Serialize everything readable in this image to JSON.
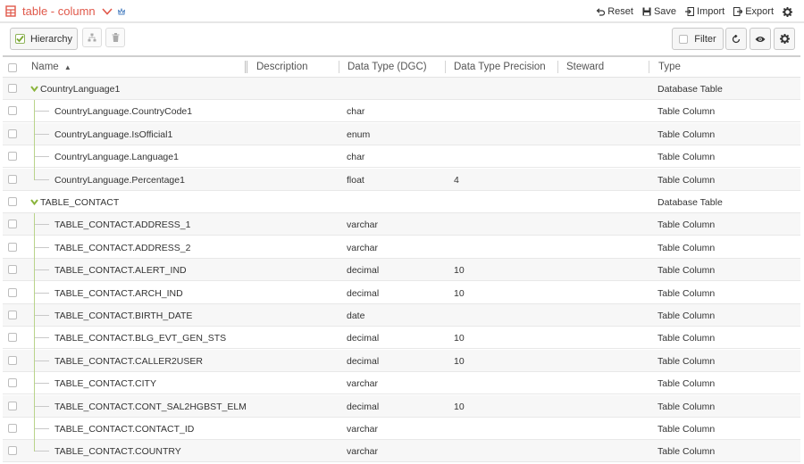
{
  "header": {
    "title": "table - column",
    "actions": [
      {
        "name": "reset",
        "label": "Reset",
        "icon": "undo-icon"
      },
      {
        "name": "save",
        "label": "Save",
        "icon": "save-icon"
      },
      {
        "name": "import",
        "label": "Import",
        "icon": "import-icon"
      },
      {
        "name": "export",
        "label": "Export",
        "icon": "export-icon"
      }
    ]
  },
  "toolbar": {
    "hierarchy_label": "Hierarchy",
    "filter_label": "Filter"
  },
  "columns": [
    "Name",
    "Description",
    "Data Type (DGC)",
    "Data Type Precision",
    "Steward",
    "Type"
  ],
  "sort_indicator": "▲",
  "rows": [
    {
      "level": 0,
      "name": "CountryLanguage1",
      "description": "",
      "data_type": "",
      "precision": "",
      "steward": "",
      "type": "Database Table"
    },
    {
      "level": 1,
      "name": "CountryLanguage.CountryCode1",
      "description": "",
      "data_type": "char",
      "precision": "",
      "steward": "",
      "type": "Table Column"
    },
    {
      "level": 1,
      "name": "CountryLanguage.IsOfficial1",
      "description": "",
      "data_type": "enum",
      "precision": "",
      "steward": "",
      "type": "Table Column"
    },
    {
      "level": 1,
      "name": "CountryLanguage.Language1",
      "description": "",
      "data_type": "char",
      "precision": "",
      "steward": "",
      "type": "Table Column"
    },
    {
      "level": 1,
      "name": "CountryLanguage.Percentage1",
      "description": "",
      "data_type": "float",
      "precision": "4",
      "steward": "",
      "type": "Table Column"
    },
    {
      "level": 0,
      "name": "TABLE_CONTACT",
      "description": "",
      "data_type": "",
      "precision": "",
      "steward": "",
      "type": "Database Table"
    },
    {
      "level": 1,
      "name": "TABLE_CONTACT.ADDRESS_1",
      "description": "",
      "data_type": "varchar",
      "precision": "",
      "steward": "",
      "type": "Table Column"
    },
    {
      "level": 1,
      "name": "TABLE_CONTACT.ADDRESS_2",
      "description": "",
      "data_type": "varchar",
      "precision": "",
      "steward": "",
      "type": "Table Column"
    },
    {
      "level": 1,
      "name": "TABLE_CONTACT.ALERT_IND",
      "description": "",
      "data_type": "decimal",
      "precision": "10",
      "steward": "",
      "type": "Table Column"
    },
    {
      "level": 1,
      "name": "TABLE_CONTACT.ARCH_IND",
      "description": "",
      "data_type": "decimal",
      "precision": "10",
      "steward": "",
      "type": "Table Column"
    },
    {
      "level": 1,
      "name": "TABLE_CONTACT.BIRTH_DATE",
      "description": "",
      "data_type": "date",
      "precision": "",
      "steward": "",
      "type": "Table Column"
    },
    {
      "level": 1,
      "name": "TABLE_CONTACT.BLG_EVT_GEN_STS",
      "description": "",
      "data_type": "decimal",
      "precision": "10",
      "steward": "",
      "type": "Table Column"
    },
    {
      "level": 1,
      "name": "TABLE_CONTACT.CALLER2USER",
      "description": "",
      "data_type": "decimal",
      "precision": "10",
      "steward": "",
      "type": "Table Column"
    },
    {
      "level": 1,
      "name": "TABLE_CONTACT.CITY",
      "description": "",
      "data_type": "varchar",
      "precision": "",
      "steward": "",
      "type": "Table Column"
    },
    {
      "level": 1,
      "name": "TABLE_CONTACT.CONT_SAL2HGBST_ELM",
      "description": "",
      "data_type": "decimal",
      "precision": "10",
      "steward": "",
      "type": "Table Column"
    },
    {
      "level": 1,
      "name": "TABLE_CONTACT.CONTACT_ID",
      "description": "",
      "data_type": "varchar",
      "precision": "",
      "steward": "",
      "type": "Table Column"
    },
    {
      "level": 1,
      "name": "TABLE_CONTACT.COUNTRY",
      "description": "",
      "data_type": "varchar",
      "precision": "",
      "steward": "",
      "type": "Table Column"
    }
  ],
  "colors": {
    "title": "#e0584a",
    "tree_accent": "#8ab43c",
    "row_alt": "#f7f7f7"
  }
}
